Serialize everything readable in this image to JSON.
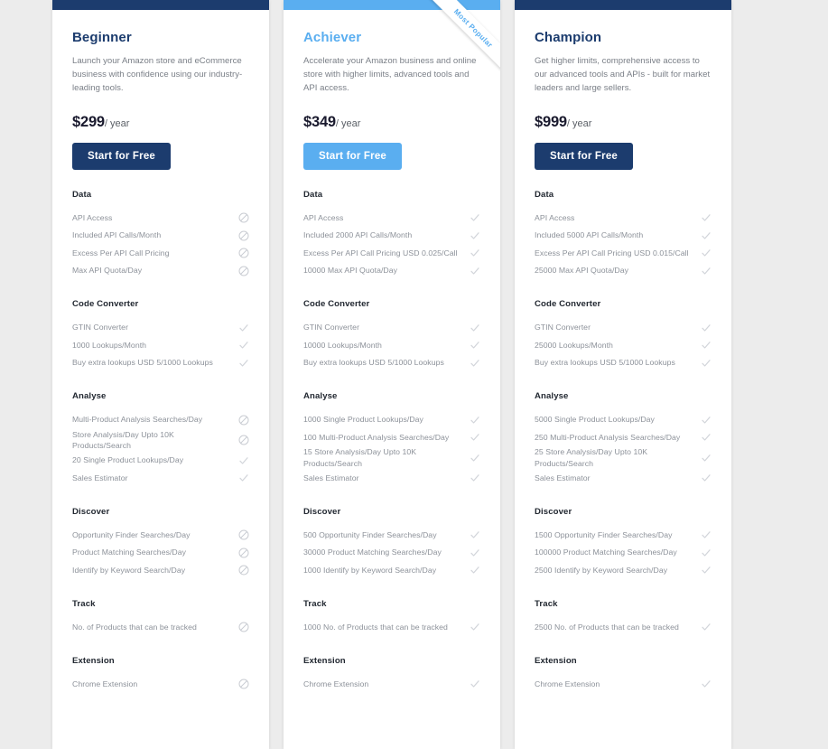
{
  "theme": {
    "page_background": "#ececec",
    "card_background": "#ffffff",
    "navy": "#1c3c6e",
    "blue": "#5aaef0",
    "muted_text": "#8c9199",
    "heading_text": "#222831"
  },
  "ribbon": {
    "label": "Most Popular"
  },
  "group_titles": {
    "data": "Data",
    "code_converter": "Code Converter",
    "analyse": "Analyse",
    "discover": "Discover",
    "track": "Track",
    "extension": "Extension"
  },
  "plans": [
    {
      "id": "beginner",
      "name": "Beginner",
      "description": "Launch your Amazon store and eCommerce business with confidence using our industry-leading tools.",
      "price": "$299",
      "period": "/ year",
      "cta_label": "Start for Free",
      "accent": "navy",
      "most_popular": false,
      "groups": [
        {
          "key": "data",
          "title": "Data",
          "features": [
            {
              "label": "API Access",
              "mark": "blocked"
            },
            {
              "label": "Included API Calls/Month",
              "mark": "blocked"
            },
            {
              "label": "Excess Per API Call Pricing",
              "mark": "blocked"
            },
            {
              "label": "Max API Quota/Day",
              "mark": "blocked"
            }
          ]
        },
        {
          "key": "code_converter",
          "title": "Code Converter",
          "features": [
            {
              "label": "GTIN Converter",
              "mark": "check"
            },
            {
              "label": "1000 Lookups/Month",
              "mark": "check"
            },
            {
              "label": "Buy extra lookups USD 5/1000 Lookups",
              "mark": "check"
            }
          ]
        },
        {
          "key": "analyse",
          "title": "Analyse",
          "features": [
            {
              "label": "Multi-Product Analysis Searches/Day",
              "mark": "blocked"
            },
            {
              "label": "Store Analysis/Day Upto 10K Products/Search",
              "mark": "blocked"
            },
            {
              "label": "20 Single Product Lookups/Day",
              "mark": "check"
            },
            {
              "label": "Sales Estimator",
              "mark": "check"
            }
          ]
        },
        {
          "key": "discover",
          "title": "Discover",
          "features": [
            {
              "label": "Opportunity Finder Searches/Day",
              "mark": "blocked"
            },
            {
              "label": "Product Matching Searches/Day",
              "mark": "blocked"
            },
            {
              "label": "Identify by Keyword Search/Day",
              "mark": "blocked"
            }
          ]
        },
        {
          "key": "track",
          "title": "Track",
          "features": [
            {
              "label": "No. of Products that can be tracked",
              "mark": "blocked"
            }
          ]
        },
        {
          "key": "extension",
          "title": "Extension",
          "features": [
            {
              "label": "Chrome Extension",
              "mark": "blocked"
            }
          ]
        }
      ]
    },
    {
      "id": "achiever",
      "name": "Achiever",
      "description": "Accelerate your Amazon business and online store with higher limits, advanced tools and API access.",
      "price": "$349",
      "period": "/ year",
      "cta_label": "Start for Free",
      "accent": "blue",
      "most_popular": true,
      "groups": [
        {
          "key": "data",
          "title": "Data",
          "features": [
            {
              "label": "API Access",
              "mark": "check"
            },
            {
              "label": "Included 2000 API Calls/Month",
              "mark": "check"
            },
            {
              "label": "Excess Per API Call Pricing USD 0.025/Call",
              "mark": "check"
            },
            {
              "label": "10000 Max API Quota/Day",
              "mark": "check"
            }
          ]
        },
        {
          "key": "code_converter",
          "title": "Code Converter",
          "features": [
            {
              "label": "GTIN Converter",
              "mark": "check"
            },
            {
              "label": "10000 Lookups/Month",
              "mark": "check"
            },
            {
              "label": "Buy extra lookups USD 5/1000 Lookups",
              "mark": "check"
            }
          ]
        },
        {
          "key": "analyse",
          "title": "Analyse",
          "features": [
            {
              "label": "1000 Single Product Lookups/Day",
              "mark": "check"
            },
            {
              "label": "100 Multi-Product Analysis Searches/Day",
              "mark": "check"
            },
            {
              "label": "15 Store Analysis/Day Upto 10K Products/Search",
              "mark": "check"
            },
            {
              "label": "Sales Estimator",
              "mark": "check"
            }
          ]
        },
        {
          "key": "discover",
          "title": "Discover",
          "features": [
            {
              "label": "500 Opportunity Finder Searches/Day",
              "mark": "check"
            },
            {
              "label": "30000 Product Matching Searches/Day",
              "mark": "check"
            },
            {
              "label": "1000 Identify by Keyword Search/Day",
              "mark": "check"
            }
          ]
        },
        {
          "key": "track",
          "title": "Track",
          "features": [
            {
              "label": "1000 No. of Products that can be tracked",
              "mark": "check"
            }
          ]
        },
        {
          "key": "extension",
          "title": "Extension",
          "features": [
            {
              "label": "Chrome Extension",
              "mark": "check"
            }
          ]
        }
      ]
    },
    {
      "id": "champion",
      "name": "Champion",
      "description": "Get higher limits, comprehensive access to our advanced tools and APIs - built for market leaders and large sellers.",
      "price": "$999",
      "period": "/ year",
      "cta_label": "Start for Free",
      "accent": "navy",
      "most_popular": false,
      "groups": [
        {
          "key": "data",
          "title": "Data",
          "features": [
            {
              "label": "API Access",
              "mark": "check"
            },
            {
              "label": "Included 5000 API Calls/Month",
              "mark": "check"
            },
            {
              "label": "Excess Per API Call Pricing USD 0.015/Call",
              "mark": "check"
            },
            {
              "label": "25000 Max API Quota/Day",
              "mark": "check"
            }
          ]
        },
        {
          "key": "code_converter",
          "title": "Code Converter",
          "features": [
            {
              "label": "GTIN Converter",
              "mark": "check"
            },
            {
              "label": "25000 Lookups/Month",
              "mark": "check"
            },
            {
              "label": "Buy extra lookups USD 5/1000 Lookups",
              "mark": "check"
            }
          ]
        },
        {
          "key": "analyse",
          "title": "Analyse",
          "features": [
            {
              "label": "5000 Single Product Lookups/Day",
              "mark": "check"
            },
            {
              "label": "250 Multi-Product Analysis Searches/Day",
              "mark": "check"
            },
            {
              "label": "25 Store Analysis/Day Upto 10K Products/Search",
              "mark": "check"
            },
            {
              "label": "Sales Estimator",
              "mark": "check"
            }
          ]
        },
        {
          "key": "discover",
          "title": "Discover",
          "features": [
            {
              "label": "1500 Opportunity Finder Searches/Day",
              "mark": "check"
            },
            {
              "label": "100000 Product Matching Searches/Day",
              "mark": "check"
            },
            {
              "label": "2500 Identify by Keyword Search/Day",
              "mark": "check"
            }
          ]
        },
        {
          "key": "track",
          "title": "Track",
          "features": [
            {
              "label": "2500 No. of Products that can be tracked",
              "mark": "check"
            }
          ]
        },
        {
          "key": "extension",
          "title": "Extension",
          "features": [
            {
              "label": "Chrome Extension",
              "mark": "check"
            }
          ]
        }
      ]
    }
  ]
}
